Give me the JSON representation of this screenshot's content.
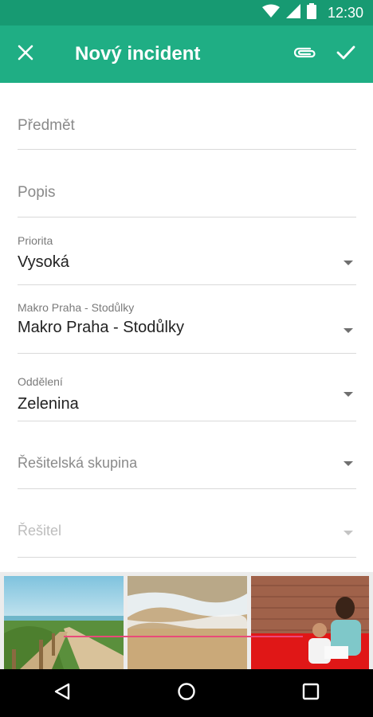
{
  "status_bar": {
    "time": "12:30",
    "icons": [
      "wifi-icon",
      "signal-icon",
      "battery-icon"
    ]
  },
  "app_bar": {
    "title": "Nový incident",
    "icons": [
      "close-icon",
      "paperclip-icon",
      "check-icon"
    ]
  },
  "form": {
    "subject_placeholder": "Předmět",
    "description_placeholder": "Popis",
    "priority": {
      "label": "Priorita",
      "value": "Vysoká"
    },
    "store": {
      "label": "Makro Praha - Stodůlky",
      "value": "Makro Praha - Stodůlky"
    },
    "department": {
      "label": "Oddělení",
      "value": "Zelenina"
    },
    "solver_group_placeholder": "Řešitelská skupina",
    "solver_placeholder": "Řešitel"
  },
  "attachments": [
    "beach-boardwalk-photo",
    "sea-waves-photo",
    "mother-child-reading-photo"
  ],
  "nav_bar": {
    "icons": [
      "back-icon",
      "home-icon",
      "recents-icon"
    ]
  },
  "colors": {
    "status_bar": "#179a72",
    "app_bar": "#1fae84",
    "divider": "#d9d9d9"
  }
}
